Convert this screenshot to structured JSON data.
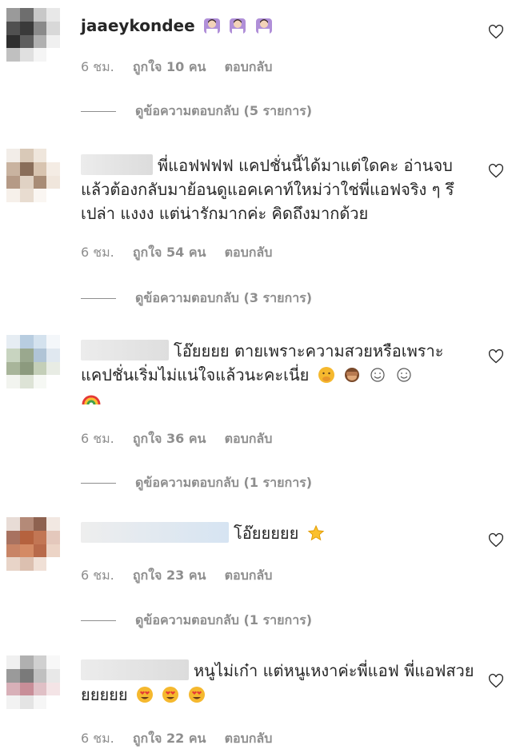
{
  "comments": [
    {
      "username": "jaaeykondee",
      "text": "",
      "emoji": [
        "person-raising-hand",
        "person-raising-hand",
        "person-raising-hand"
      ],
      "time": "6 ชม.",
      "likes": "ถูกใจ 10 คน",
      "reply": "ตอบกลับ",
      "view_replies": "ดูข้อความตอบกลับ (5 รายการ)",
      "avatar_colors": [
        "#9a9a9a",
        "#6e6e6e",
        "#c8c8c8",
        "#e8e8e8",
        "#505050",
        "#3a3a3a",
        "#8a8a8a",
        "#d8d8d8",
        "#2e2e2e",
        "#5e5e5e",
        "#b0b0b0",
        "#f0f0f0",
        "#c0c0c0",
        "#e0e0e0",
        "#f5f5f5",
        "#ffffff"
      ]
    },
    {
      "username": "",
      "text": "พี่แอฟฟฟฟ แคปชั่นนี้ได้มาแต่ใดคะ อ่านจบแล้วต้องกลับมาย้อนดูแอคเคาท์ใหม่ว่าใช่พี่แอฟจริง ๆ รึเปล่า แงงง แต่น่ารักมากค่ะ คิดถึงมากด้วย",
      "emoji": [],
      "time": "6 ชม.",
      "likes": "ถูกใจ 54 คน",
      "reply": "ตอบกลับ",
      "view_replies": "ดูข้อความตอบกลับ (3 รายการ)",
      "avatar_colors": [
        "#f2ede8",
        "#d9c9b8",
        "#efe6dc",
        "#ffffff",
        "#c9b3a0",
        "#8a6e5a",
        "#d8c4b0",
        "#f4ece4",
        "#b59a86",
        "#e0d2c4",
        "#a88c76",
        "#f0e6dc",
        "#f6f0ea",
        "#e8dcd0",
        "#faf6f2",
        "#ffffff"
      ]
    },
    {
      "username": "",
      "text": "โอ๊ยยยย ตายเพราะความสวยหรือเพราะแคปชั่นเริ่มไม่แน่ใจแล้วนะคะเนี่ย",
      "emoji": [
        "hand-over-mouth",
        "see-no-evil-monkey",
        "smile",
        "smile",
        "rainbow"
      ],
      "time": "6 ชม.",
      "likes": "ถูกใจ 36 คน",
      "reply": "ตอบกลับ",
      "view_replies": "ดูข้อความตอบกลับ (1 รายการ)",
      "avatar_colors": [
        "#e6edf3",
        "#b8cde0",
        "#d4e2ee",
        "#f4f7fa",
        "#c8d4c0",
        "#9aa88e",
        "#b0c4d6",
        "#e0e8f0",
        "#a8b59a",
        "#8c9a7e",
        "#c4cfb8",
        "#e8ece4",
        "#f2f4ef",
        "#dde3d6",
        "#f6f8f4",
        "#ffffff"
      ]
    },
    {
      "username": "",
      "text": "โอ๊ยยยยย",
      "emoji": [
        "star"
      ],
      "time": "6 ชม.",
      "likes": "ถูกใจ 23 คน",
      "reply": "ตอบกลับ",
      "view_replies": "ดูข้อความตอบกลับ (1 รายการ)",
      "avatar_colors": [
        "#e8dcd6",
        "#b48a78",
        "#8e6250",
        "#f2e8e2",
        "#a87260",
        "#b5623e",
        "#c27654",
        "#e4c8bc",
        "#c88466",
        "#d48a64",
        "#b86a4a",
        "#ecd4c6",
        "#e8d4c8",
        "#dcc0b0",
        "#f0e0d6",
        "#ffffff"
      ]
    },
    {
      "username": "",
      "text": "หนูไม่เก๋า แต่หนูเหงาค่ะพี่แอฟ พี่แอฟสวยยยยยย",
      "emoji": [
        "heart-eyes",
        "heart-eyes",
        "heart-eyes"
      ],
      "time": "6 ชม.",
      "likes": "ถูกใจ 22 คน",
      "reply": "ตอบกลับ",
      "view_replies": "",
      "avatar_colors": [
        "#f0f0f0",
        "#b0b0b0",
        "#d0d0d0",
        "#f8f8f8",
        "#9a9a9a",
        "#7a7a7a",
        "#c0c0c0",
        "#e8e8e8",
        "#d8b0b8",
        "#c88e98",
        "#e0c0c6",
        "#f4e4e6",
        "#f2f2f2",
        "#e4e4e4",
        "#f6f6f6",
        "#ffffff"
      ]
    }
  ]
}
